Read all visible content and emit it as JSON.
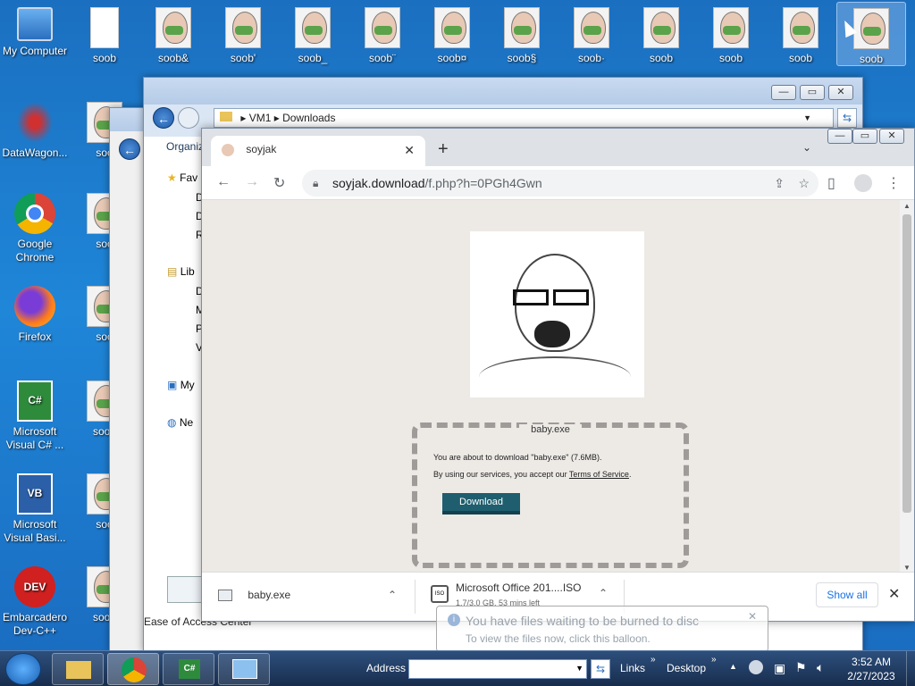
{
  "desktop": {
    "left_icons": [
      {
        "label": "My Computer"
      },
      {
        "label": "DataWagon..."
      },
      {
        "label": "Google Chrome"
      },
      {
        "label": "Firefox"
      },
      {
        "label": "Microsoft Visual C# ..."
      },
      {
        "label": "Microsoft Visual Basi..."
      },
      {
        "label": "Embarcadero Dev-C++"
      }
    ],
    "top_icons": [
      {
        "label": "soob"
      },
      {
        "label": "soob&"
      },
      {
        "label": "soob'"
      },
      {
        "label": "soob_"
      },
      {
        "label": "soob¨"
      },
      {
        "label": "soob¤"
      },
      {
        "label": "soob§"
      },
      {
        "label": "soob·"
      },
      {
        "label": "soob"
      },
      {
        "label": "soob"
      },
      {
        "label": "soob"
      },
      {
        "label": "soob"
      }
    ],
    "column_icons": [
      {
        "label": "soo"
      },
      {
        "label": "soo"
      },
      {
        "label": "soo"
      },
      {
        "label": "soob"
      },
      {
        "label": "soo"
      },
      {
        "label": "soob"
      }
    ]
  },
  "explorer": {
    "breadcrumb": [
      "VM1",
      "Downloads"
    ],
    "organize_label": "Organiz",
    "favorites_label": "Fav",
    "libraries_label": "Lib",
    "my_label": "My",
    "network_label": "Ne",
    "nav_letters": [
      "D",
      "D",
      "R",
      "D",
      "M",
      "P",
      "V"
    ],
    "ease_of_access": "Ease of Access Center"
  },
  "chrome": {
    "tab_title": "soyjak",
    "new_tab_symbol": "+",
    "url_host": "soyjak.download",
    "url_path": "/f.php?h=0PGh4Gwn",
    "page": {
      "file_title": "baby.exe",
      "line1": "You are about to download \"baby.exe\" (7.6MB).",
      "line2_prefix": "By using our services, you accept our ",
      "terms_link": "Terms of Service",
      "line2_suffix": ".",
      "download_button": "Download"
    },
    "download_shelf": {
      "item1_name": "baby.exe",
      "item2_name": "Microsoft Office 201....ISO",
      "item2_status": "1.7/3.0 GB, 53 mins left",
      "show_all": "Show all"
    }
  },
  "balloon": {
    "title": "You have files waiting to be burned to disc",
    "body": "To view the files now, click this balloon."
  },
  "taskbar": {
    "address_label": "Address",
    "links_label": "Links",
    "desktop_label": "Desktop",
    "time": "3:52 AM",
    "date": "2/27/2023"
  }
}
